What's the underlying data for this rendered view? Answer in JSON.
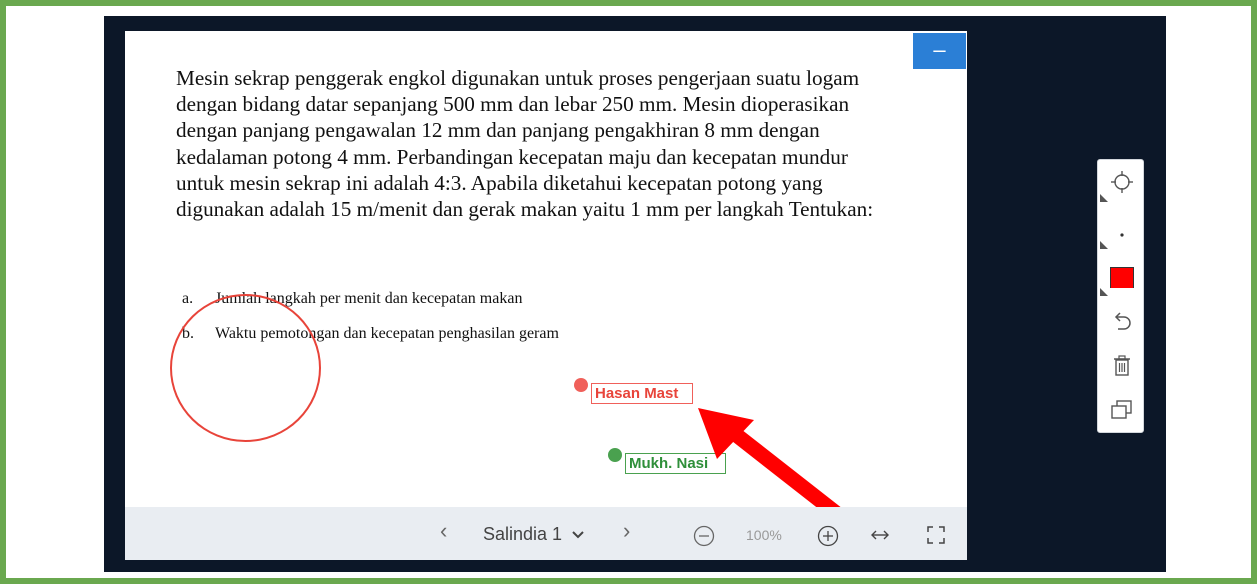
{
  "slide": {
    "paragraph": "Mesin sekrap penggerak engkol digunakan untuk proses pengerjaan suatu logam dengan bidang datar sepanjang 500 mm dan lebar 250 mm. Mesin dioperasikan dengan panjang pengawalan 12 mm dan panjang pengakhiran 8 mm dengan kedalaman potong 4 mm. Perbandingan kecepatan maju dan kecepatan mundur untuk mesin sekrap ini adalah 4:3.  Apabila diketahui kecepatan potong yang digunakan adalah 15 m/menit dan gerak makan  yaitu  1 mm per langkah  Tentukan:",
    "items": [
      {
        "marker": "a.",
        "text": "Jumlah langkah per menit  dan kecepatan makan"
      },
      {
        "marker": "b.",
        "text": "Waktu pemotongan dan kecepatan penghasilan geram"
      }
    ]
  },
  "cursors": [
    {
      "name": "Hasan Mast",
      "color": "#f0605a"
    },
    {
      "name": "Mukh. Nasi",
      "color": "#4aa14f"
    }
  ],
  "bottom_bar": {
    "slide_label": "Salindia 1",
    "zoom": "100%"
  },
  "colors": {
    "frame_border": "#6aa84f",
    "stage_bg": "#0c1728",
    "minimize_button": "#2b7fd6",
    "annotation_circle": "#e8443a",
    "arrow": "#ff0000",
    "pen_color_swatch": "#ff0000"
  },
  "icons": {
    "toolbar": [
      "crosshair-icon",
      "pen-size-icon",
      "color-swatch-icon",
      "undo-icon",
      "trash-icon",
      "window-icon"
    ],
    "bottom_bar": [
      "chevron-left-icon",
      "chevron-down-icon",
      "chevron-right-icon",
      "zoom-out-icon",
      "zoom-in-icon",
      "fit-width-icon",
      "fullscreen-icon"
    ]
  }
}
